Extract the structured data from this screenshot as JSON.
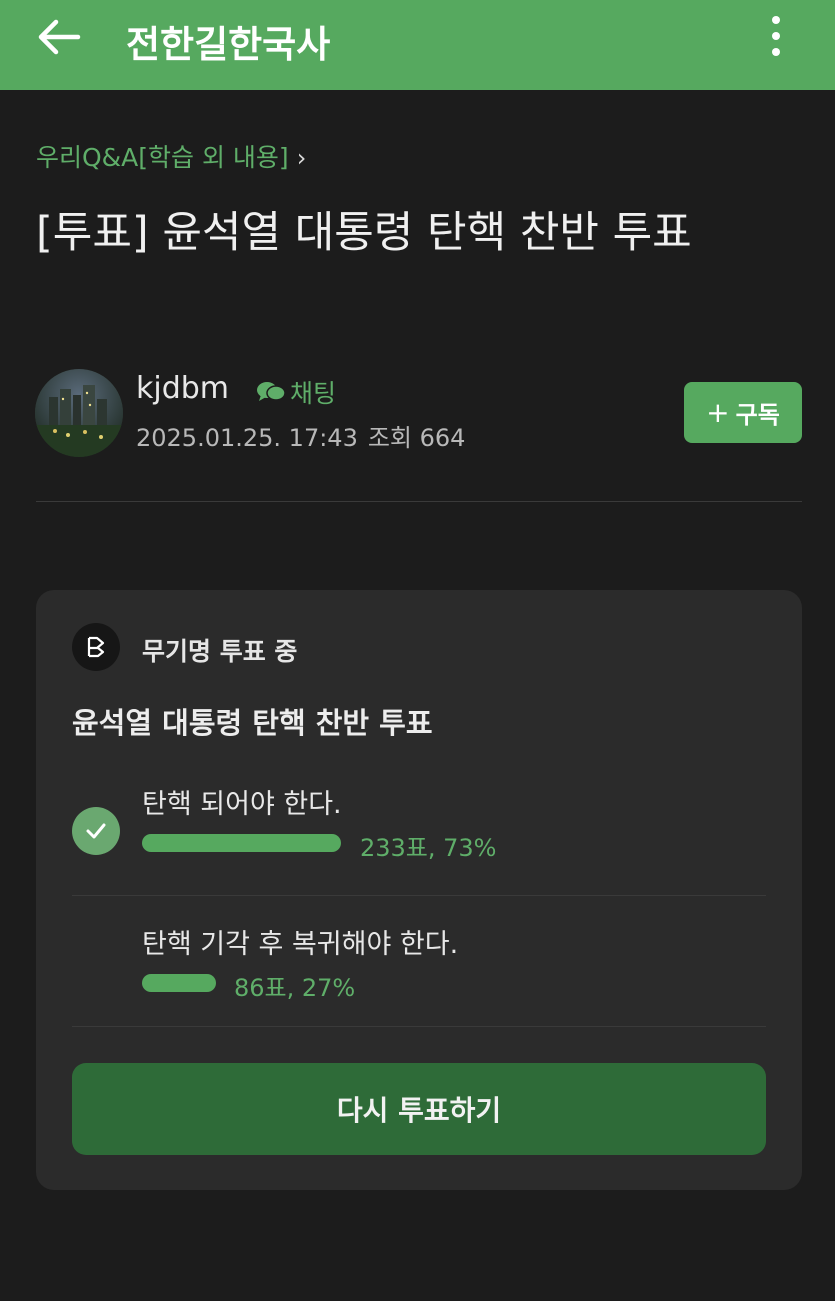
{
  "header": {
    "title": "전한길한국사",
    "back_icon": "arrow-left-icon",
    "more_icon": "more-vertical-icon"
  },
  "post": {
    "breadcrumb": "우리Q&A[학습 외 내용]",
    "title": "[투표] 윤석열 대통령 탄핵 찬반 투표"
  },
  "author": {
    "name": "kjdbm",
    "chat_label": "채팅",
    "date": "2025.01.25. 17:43",
    "views_label": "조회 664"
  },
  "subscribe": {
    "label": "구독"
  },
  "poll": {
    "status": "무기명 투표 중",
    "title": "윤석열 대통령 탄핵 찬반 투표",
    "options": [
      {
        "label": "탄핵 되어야 한다.",
        "votes_text": "233표, 73%",
        "percent": 73,
        "selected": true
      },
      {
        "label": "탄핵 기각 후 복귀해야 한다.",
        "votes_text": "86표, 27%",
        "percent": 27,
        "selected": false
      }
    ],
    "revote_label": "다시 투표하기"
  },
  "colors": {
    "accent": "#56a95f",
    "background": "#1c1c1c",
    "card": "#2b2b2b",
    "button_dark_green": "#2e6b38"
  }
}
